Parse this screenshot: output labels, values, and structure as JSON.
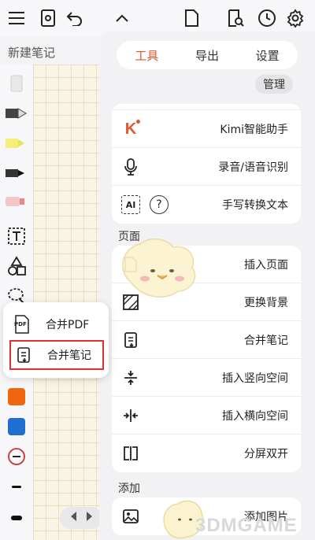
{
  "note": {
    "title": "新建笔记"
  },
  "tabs": [
    {
      "label": "工具",
      "active": true
    },
    {
      "label": "导出",
      "active": false
    },
    {
      "label": "设置",
      "active": false
    }
  ],
  "manage_label": "管理",
  "tools_card": [
    {
      "label": "Kimi智能助手",
      "icon": "kimi-logo-icon"
    },
    {
      "label": "录音/语音识别",
      "icon": "microphone-icon"
    },
    {
      "label": "手写转换文本",
      "icon": "ai-text-icon"
    }
  ],
  "sections": {
    "page": "页面",
    "add": "添加"
  },
  "page_card": [
    {
      "label": "插入页面",
      "icon": "insert-page-icon"
    },
    {
      "label": "更换背景",
      "icon": "background-icon"
    },
    {
      "label": "合并笔记",
      "icon": "merge-note-icon"
    },
    {
      "label": "插入竖向空间",
      "icon": "vertical-space-icon"
    },
    {
      "label": "插入横向空间",
      "icon": "horizontal-space-icon"
    },
    {
      "label": "分屏双开",
      "icon": "split-screen-icon"
    }
  ],
  "add_card": [
    {
      "label": "添加图片",
      "icon": "image-icon"
    }
  ],
  "popup": {
    "items": [
      {
        "label": "合并PDF",
        "icon_text": "PDF"
      },
      {
        "label": "合并笔记",
        "highlighted": true
      }
    ]
  },
  "ai_icon_text": "AI",
  "question_icon_text": "?",
  "kimi_glyph": "K",
  "watermark_text": "3DMGAME",
  "colors": {
    "accent": "#e2562d",
    "orange_swatch": "#f0650f",
    "blue_swatch": "#1e6fd0",
    "highlight": "#e03131"
  }
}
